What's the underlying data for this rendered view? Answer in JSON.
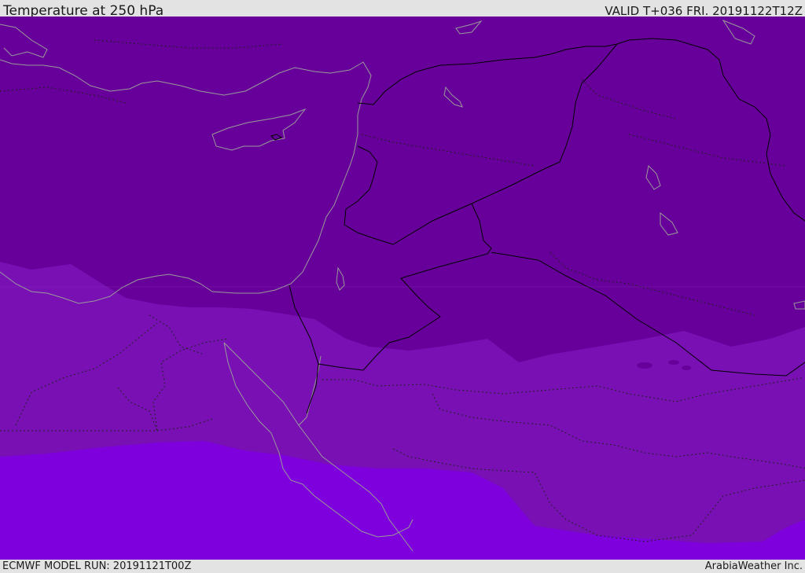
{
  "header": {
    "title": "Temperature at 250 hPa",
    "valid": "VALID T+036 FRI. 20191122T12Z"
  },
  "footer": {
    "model_run": "ECMWF MODEL RUN: 20191121T00Z",
    "credit": "ArabiaWeather Inc."
  },
  "colors": {
    "band_cold": "#67009a",
    "band_mid": "#7810b4",
    "band_warm": "#7e00dc",
    "coast": "#9a9a9a",
    "border": "#000000"
  }
}
